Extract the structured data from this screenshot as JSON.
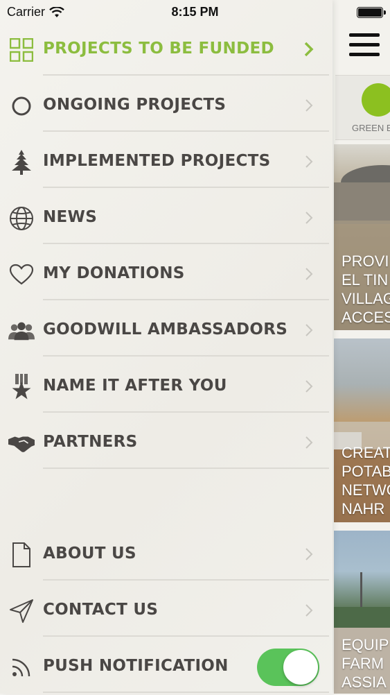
{
  "status_bar": {
    "carrier": "Carrier",
    "time": "8:15 PM"
  },
  "menu": {
    "items": [
      {
        "label": "PROJECTS TO BE FUNDED",
        "icon": "grid-icon",
        "active": true
      },
      {
        "label": "ONGOING PROJECTS",
        "icon": "circle-icon"
      },
      {
        "label": "IMPLEMENTED PROJECTS",
        "icon": "cedar-tree-icon"
      },
      {
        "label": "NEWS",
        "icon": "globe-icon"
      },
      {
        "label": "MY DONATIONS",
        "icon": "heart-icon"
      },
      {
        "label": "GOODWILL AMBASSADORS",
        "icon": "people-icon"
      },
      {
        "label": "NAME IT AFTER YOU",
        "icon": "star-ribbon-icon"
      },
      {
        "label": "PARTNERS",
        "icon": "handshake-icon"
      },
      {
        "label": "ABOUT US",
        "icon": "document-icon"
      },
      {
        "label": "CONTACT US",
        "icon": "paper-plane-icon"
      },
      {
        "label": "PUSH NOTIFICATION",
        "icon": "rss-icon"
      }
    ],
    "push_notification_enabled": true
  },
  "main": {
    "category_label": "GREEN E",
    "cards": [
      {
        "caption": "PROVI\nEL TIN\nVILLAG\nACCES"
      },
      {
        "caption": "CREAT\nPOTAB\nNETWO\nNAHR"
      },
      {
        "caption": "EQUIP\nFARM\nASSIA"
      }
    ]
  },
  "colors": {
    "accent_green": "#8cbd3f",
    "toggle_green": "#5ac35a",
    "label_gray": "#4a4745"
  }
}
